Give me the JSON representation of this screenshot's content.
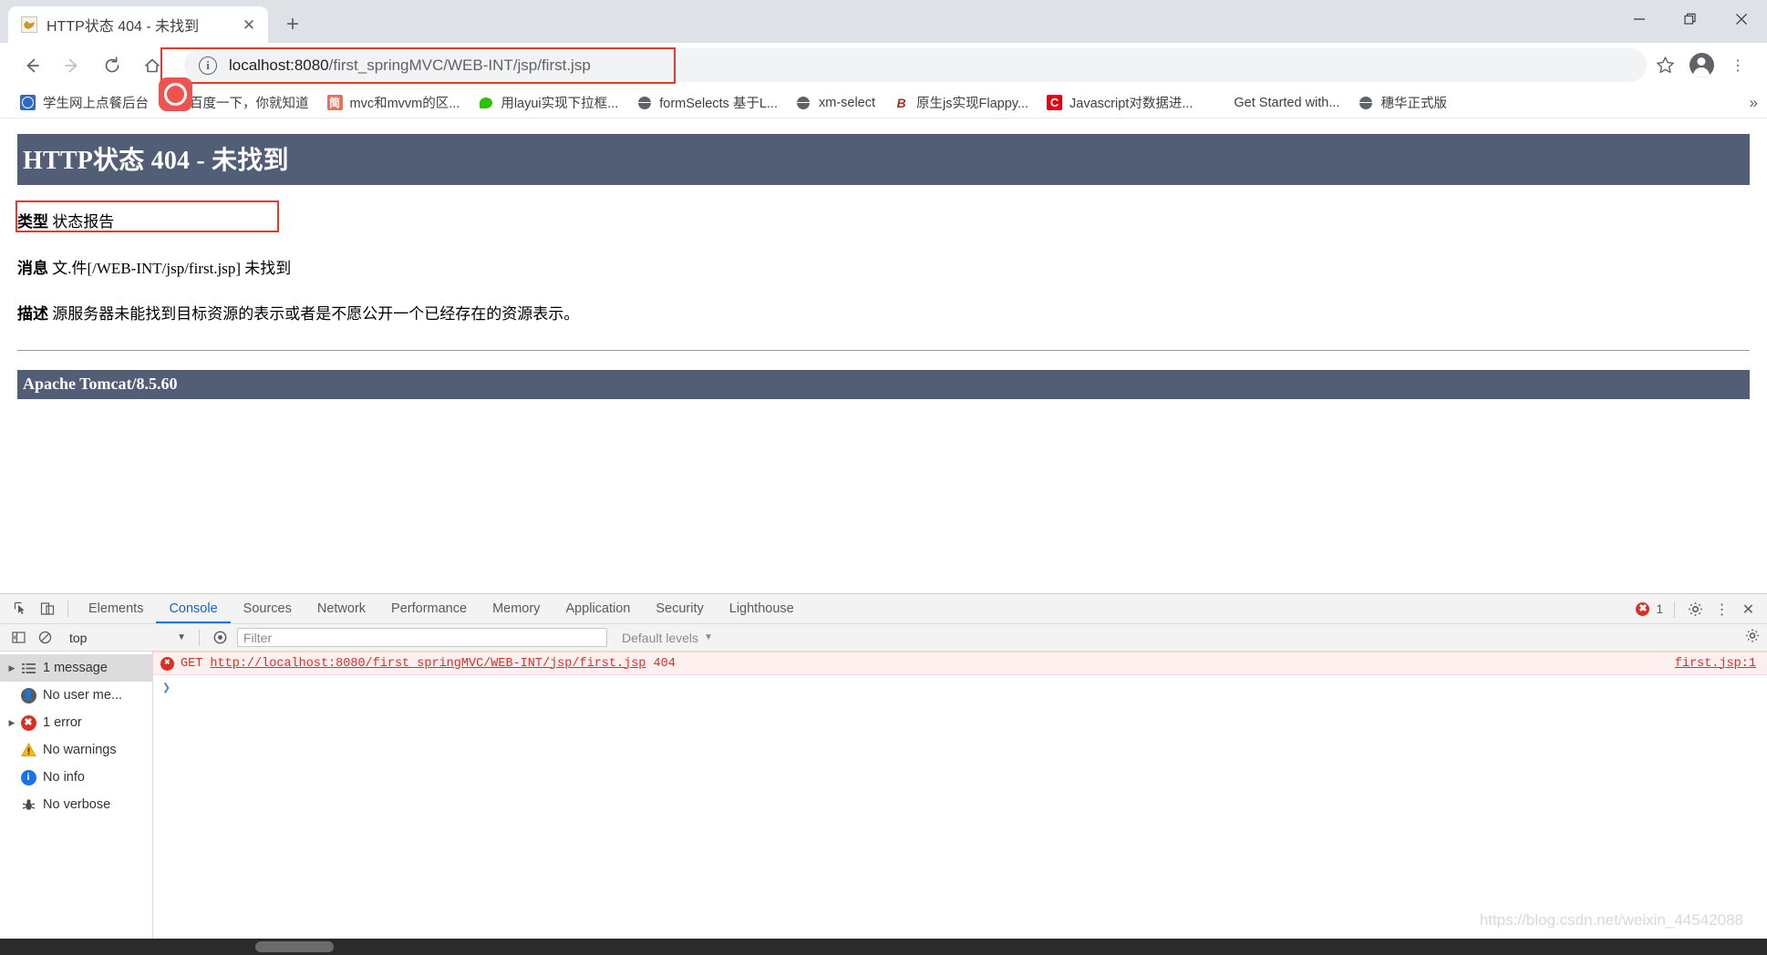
{
  "window": {
    "minimize_label": "minimize",
    "maximize_label": "restore",
    "close_label": "close"
  },
  "tabstrip": {
    "tabs": [
      {
        "title": "HTTP状态 404 - 未找到",
        "favicon": "tomcat-icon",
        "close_label": "✕"
      }
    ],
    "new_tab_label": "+"
  },
  "toolbar": {
    "back_label": "←",
    "forward_label": "→",
    "reload_label": "↻",
    "home_label": "⌂",
    "url_scheme_host": "localhost:8080",
    "url_path": "/first_springMVC/WEB-INT/jsp/first.jsp",
    "url_full": "localhost:8080/first_springMVC/WEB-INT/jsp/first.jsp",
    "info_icon_label": "ⓘ",
    "star_label": "☆",
    "profile_label": "profile",
    "menu_label": "⋮"
  },
  "bookmarks": {
    "items": [
      {
        "label": "学生网上点餐后台",
        "icon": "globe-blue-icon"
      },
      {
        "label": "百度一下，你就知道",
        "icon": "baidu-icon"
      },
      {
        "label": "mvc和mvvm的区...",
        "icon": "jianshu-icon"
      },
      {
        "label": "用layui实现下拉框...",
        "icon": "wechat-icon"
      },
      {
        "label": "formSelects 基于L...",
        "icon": "globe-gray-icon"
      },
      {
        "label": "xm-select",
        "icon": "globe-gray-icon"
      },
      {
        "label": "原生js实现Flappy...",
        "icon": "bilibili-icon"
      },
      {
        "label": "Javascript对数据进...",
        "icon": "csdn-icon"
      },
      {
        "label": "Get Started with...",
        "icon": "microsoft-icon"
      },
      {
        "label": "穗华正式版",
        "icon": "globe-gray-icon"
      }
    ],
    "overflow_label": "»"
  },
  "page": {
    "banner_title": "HTTP状态 404 - 未找到",
    "rows": [
      {
        "key": "类型",
        "value": "状态报告"
      },
      {
        "key": "消息",
        "value": "文.件[/WEB-INT/jsp/first.jsp] 未找到"
      },
      {
        "key": "描述",
        "value": "源服务器未能找到目标资源的表示或者是不愿公开一个已经存在的资源表示。"
      }
    ],
    "footer": "Apache Tomcat/8.5.60"
  },
  "devtools": {
    "inspect_icon_label": "inspect",
    "device_icon_label": "device-toolbar",
    "tabs": [
      {
        "label": "Elements",
        "active": false
      },
      {
        "label": "Console",
        "active": true
      },
      {
        "label": "Sources",
        "active": false
      },
      {
        "label": "Network",
        "active": false
      },
      {
        "label": "Performance",
        "active": false
      },
      {
        "label": "Memory",
        "active": false
      },
      {
        "label": "Application",
        "active": false
      },
      {
        "label": "Security",
        "active": false
      },
      {
        "label": "Lighthouse",
        "active": false
      }
    ],
    "error_count": "1",
    "settings_label": "⚙",
    "more_label": "⋮",
    "close_label": "✕",
    "console_toolbar": {
      "sidebar_toggle_label": "toggle-sidebar",
      "clear_label": "clear-console",
      "context_value": "top",
      "context_caret": "▼",
      "eye_label": "live-expression",
      "filter_placeholder": "Filter",
      "filter_value": "",
      "levels_label": "Default levels",
      "levels_caret": "▼",
      "settings_label": "⚙"
    },
    "sidebar": [
      {
        "label": "1 message",
        "icon": "list-icon",
        "arrow": "▶",
        "selected": true
      },
      {
        "label": "No user me...",
        "icon": "user-icon",
        "arrow": "",
        "selected": false
      },
      {
        "label": "1 error",
        "icon": "error-icon",
        "arrow": "▶",
        "selected": false
      },
      {
        "label": "No warnings",
        "icon": "warning-icon",
        "arrow": "",
        "selected": false
      },
      {
        "label": "No info",
        "icon": "info-icon",
        "arrow": "",
        "selected": false
      },
      {
        "label": "No verbose",
        "icon": "verbose-icon",
        "arrow": "",
        "selected": false
      }
    ],
    "console": {
      "error_method": "GET",
      "error_url": "http://localhost:8080/first_springMVC/WEB-INT/jsp/first.jsp",
      "error_status": "404",
      "error_source": "first.jsp:1",
      "prompt_symbol": "❯"
    }
  },
  "watermark": "https://blog.csdn.net/weixin_44542088",
  "colors": {
    "tomcat_banner": "#525D76",
    "annotation_red": "#e8372c",
    "error_red": "#d93025",
    "devtools_active": "#1a73e8"
  }
}
